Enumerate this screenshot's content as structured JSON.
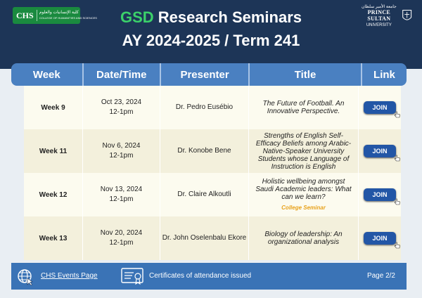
{
  "header": {
    "title_accent": "GSD",
    "title_rest": " Research Seminars",
    "subtitle": "AY 2024-2025 / Term 241",
    "left_logo": {
      "abbr": "CHS",
      "arabic": "كلية الإنسانيات والعلوم",
      "english": "COLLEGE OF HUMANITIES AND SCIENCES"
    },
    "right_logo": {
      "arabic": "جامعة الأمير سلطان",
      "name": "PRINCE SULTAN",
      "sub": "UNIVERSITY"
    }
  },
  "table": {
    "columns": [
      "Week",
      "Date/Time",
      "Presenter",
      "Title",
      "Link"
    ],
    "rows": [
      {
        "week": "Week 9",
        "date": "Oct 23, 2024",
        "time": "12-1pm",
        "presenter": "Dr. Pedro Eusébio",
        "title": "The Future of Football. An Innovative Perspective.",
        "note": "",
        "link": "JOIN"
      },
      {
        "week": "Week 11",
        "date": "Nov 6, 2024",
        "time": "12-1pm",
        "presenter": "Dr. Konobe Bene",
        "title": "Strengths of English Self-Efficacy Beliefs among Arabic-Native-Speaker University Students whose Language of Instruction is English",
        "note": "",
        "link": "JOIN"
      },
      {
        "week": "Week 12",
        "date": "Nov 13, 2024",
        "time": "12-1pm",
        "presenter": "Dr. Claire Alkoutli",
        "title": "Holistic wellbeing amongst Saudi Academic leaders: What can we learn?",
        "note": "College Seminar",
        "link": "JOIN"
      },
      {
        "week": "Week 13",
        "date": "Nov 20, 2024",
        "time": "12-1pm",
        "presenter": "Dr. John Oselenbalu Ekore",
        "title": "Biology of leadership: An organizational analysis",
        "note": "",
        "link": "JOIN"
      }
    ]
  },
  "footer": {
    "events_link": "CHS Events Page",
    "certificates": "Certificates of attendance issued",
    "page": "Page 2/2"
  },
  "colors": {
    "navy": "#1d3557",
    "accent_green": "#3bd16a",
    "header_blue": "#4a80c1",
    "join_blue": "#2256a6",
    "note_orange": "#e8a21c"
  }
}
